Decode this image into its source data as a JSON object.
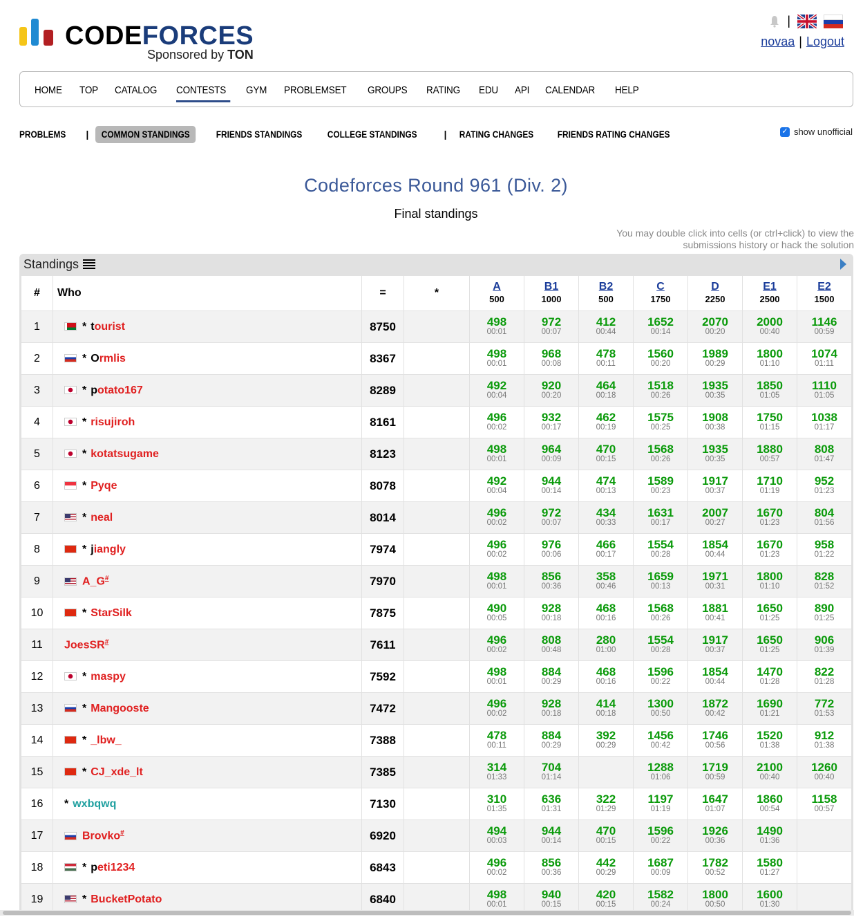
{
  "brand": {
    "word_black": "CODE",
    "word_blue": "FORCES",
    "sponsor_prefix": "Sponsored by",
    "sponsor_name": "TON"
  },
  "header": {
    "separator": "|",
    "user": "novaa",
    "logout": "Logout"
  },
  "menu": [
    "HOME",
    "TOP",
    "CATALOG",
    "CONTESTS",
    "GYM",
    "PROBLEMSET",
    "GROUPS",
    "RATING",
    "EDU",
    "API",
    "CALENDAR",
    "HELP"
  ],
  "menu_active": "CONTESTS",
  "subnav": {
    "problems": "PROBLEMS",
    "common": "COMMON STANDINGS",
    "friends": "FRIENDS STANDINGS",
    "college": "COLLEGE STANDINGS",
    "rating": "RATING CHANGES",
    "friends_rating": "FRIENDS RATING CHANGES",
    "sep": "|"
  },
  "unofficial_label": "show unofficial",
  "contest_title": "Codeforces Round 961 (Div. 2)",
  "standings_status": "Final standings",
  "hint": "You may double click into cells (or ctrl+click) to view the submissions history or hack the solution",
  "panel_title": "Standings",
  "columns": {
    "rank": "#",
    "who": "Who",
    "points": "=",
    "penalty": "*"
  },
  "problems": [
    {
      "label": "A",
      "points": "500"
    },
    {
      "label": "B1",
      "points": "1000"
    },
    {
      "label": "B2",
      "points": "500"
    },
    {
      "label": "C",
      "points": "1750"
    },
    {
      "label": "D",
      "points": "2250"
    },
    {
      "label": "E1",
      "points": "2500"
    },
    {
      "label": "E2",
      "points": "1500"
    }
  ],
  "rows": [
    {
      "rank": "1",
      "flag": "by",
      "star": true,
      "first": "t",
      "rest": "ourist",
      "color": "red",
      "sup": "",
      "score": "8750",
      "cells": [
        [
          "498",
          "00:01"
        ],
        [
          "972",
          "00:07"
        ],
        [
          "412",
          "00:44"
        ],
        [
          "1652",
          "00:14"
        ],
        [
          "2070",
          "00:20"
        ],
        [
          "2000",
          "00:40"
        ],
        [
          "1146",
          "00:59"
        ]
      ]
    },
    {
      "rank": "2",
      "flag": "ru",
      "star": true,
      "first": "O",
      "rest": "rmlis",
      "color": "red",
      "sup": "",
      "score": "8367",
      "cells": [
        [
          "498",
          "00:01"
        ],
        [
          "968",
          "00:08"
        ],
        [
          "478",
          "00:11"
        ],
        [
          "1560",
          "00:20"
        ],
        [
          "1989",
          "00:29"
        ],
        [
          "1800",
          "01:10"
        ],
        [
          "1074",
          "01:11"
        ]
      ]
    },
    {
      "rank": "3",
      "flag": "jp",
      "star": true,
      "first": "p",
      "rest": "otato167",
      "color": "red",
      "sup": "",
      "score": "8289",
      "cells": [
        [
          "492",
          "00:04"
        ],
        [
          "920",
          "00:20"
        ],
        [
          "464",
          "00:18"
        ],
        [
          "1518",
          "00:26"
        ],
        [
          "1935",
          "00:35"
        ],
        [
          "1850",
          "01:05"
        ],
        [
          "1110",
          "01:05"
        ]
      ]
    },
    {
      "rank": "4",
      "flag": "jp",
      "star": true,
      "first": "",
      "rest": "risujiroh",
      "color": "red",
      "sup": "",
      "score": "8161",
      "cells": [
        [
          "496",
          "00:02"
        ],
        [
          "932",
          "00:17"
        ],
        [
          "462",
          "00:19"
        ],
        [
          "1575",
          "00:25"
        ],
        [
          "1908",
          "00:38"
        ],
        [
          "1750",
          "01:15"
        ],
        [
          "1038",
          "01:17"
        ]
      ]
    },
    {
      "rank": "5",
      "flag": "jp",
      "star": true,
      "first": "",
      "rest": "kotatsugame",
      "color": "red",
      "sup": "",
      "score": "8123",
      "cells": [
        [
          "498",
          "00:01"
        ],
        [
          "964",
          "00:09"
        ],
        [
          "470",
          "00:15"
        ],
        [
          "1568",
          "00:26"
        ],
        [
          "1935",
          "00:35"
        ],
        [
          "1880",
          "00:57"
        ],
        [
          "808",
          "01:47"
        ]
      ]
    },
    {
      "rank": "6",
      "flag": "sg",
      "star": true,
      "first": "",
      "rest": "Pyqe",
      "color": "red",
      "sup": "",
      "score": "8078",
      "cells": [
        [
          "492",
          "00:04"
        ],
        [
          "944",
          "00:14"
        ],
        [
          "474",
          "00:13"
        ],
        [
          "1589",
          "00:23"
        ],
        [
          "1917",
          "00:37"
        ],
        [
          "1710",
          "01:19"
        ],
        [
          "952",
          "01:23"
        ]
      ]
    },
    {
      "rank": "7",
      "flag": "us",
      "star": true,
      "first": "",
      "rest": "neal",
      "color": "red",
      "sup": "",
      "score": "8014",
      "cells": [
        [
          "496",
          "00:02"
        ],
        [
          "972",
          "00:07"
        ],
        [
          "434",
          "00:33"
        ],
        [
          "1631",
          "00:17"
        ],
        [
          "2007",
          "00:27"
        ],
        [
          "1670",
          "01:23"
        ],
        [
          "804",
          "01:56"
        ]
      ]
    },
    {
      "rank": "8",
      "flag": "cn",
      "star": true,
      "first": "j",
      "rest": "iangly",
      "color": "red",
      "sup": "",
      "score": "7974",
      "cells": [
        [
          "496",
          "00:02"
        ],
        [
          "976",
          "00:06"
        ],
        [
          "466",
          "00:17"
        ],
        [
          "1554",
          "00:28"
        ],
        [
          "1854",
          "00:44"
        ],
        [
          "1670",
          "01:23"
        ],
        [
          "958",
          "01:22"
        ]
      ]
    },
    {
      "rank": "9",
      "flag": "us",
      "star": false,
      "first": "",
      "rest": "A_G",
      "color": "red",
      "sup": "#",
      "score": "7970",
      "cells": [
        [
          "498",
          "00:01"
        ],
        [
          "856",
          "00:36"
        ],
        [
          "358",
          "00:46"
        ],
        [
          "1659",
          "00:13"
        ],
        [
          "1971",
          "00:31"
        ],
        [
          "1800",
          "01:10"
        ],
        [
          "828",
          "01:52"
        ]
      ]
    },
    {
      "rank": "10",
      "flag": "cn",
      "star": true,
      "first": "",
      "rest": "StarSilk",
      "color": "red",
      "sup": "",
      "score": "7875",
      "cells": [
        [
          "490",
          "00:05"
        ],
        [
          "928",
          "00:18"
        ],
        [
          "468",
          "00:16"
        ],
        [
          "1568",
          "00:26"
        ],
        [
          "1881",
          "00:41"
        ],
        [
          "1650",
          "01:25"
        ],
        [
          "890",
          "01:25"
        ]
      ]
    },
    {
      "rank": "11",
      "flag": "",
      "star": false,
      "first": "",
      "rest": "JoesSR",
      "color": "red",
      "sup": "#",
      "score": "7611",
      "cells": [
        [
          "496",
          "00:02"
        ],
        [
          "808",
          "00:48"
        ],
        [
          "280",
          "01:00"
        ],
        [
          "1554",
          "00:28"
        ],
        [
          "1917",
          "00:37"
        ],
        [
          "1650",
          "01:25"
        ],
        [
          "906",
          "01:39"
        ]
      ]
    },
    {
      "rank": "12",
      "flag": "jp",
      "star": true,
      "first": "",
      "rest": "maspy",
      "color": "red",
      "sup": "",
      "score": "7592",
      "cells": [
        [
          "498",
          "00:01"
        ],
        [
          "884",
          "00:29"
        ],
        [
          "468",
          "00:16"
        ],
        [
          "1596",
          "00:22"
        ],
        [
          "1854",
          "00:44"
        ],
        [
          "1470",
          "01:28"
        ],
        [
          "822",
          "01:28"
        ]
      ]
    },
    {
      "rank": "13",
      "flag": "ru",
      "star": true,
      "first": "",
      "rest": "Mangooste",
      "color": "red",
      "sup": "",
      "score": "7472",
      "cells": [
        [
          "496",
          "00:02"
        ],
        [
          "928",
          "00:18"
        ],
        [
          "414",
          "00:18"
        ],
        [
          "1300",
          "00:50"
        ],
        [
          "1872",
          "00:42"
        ],
        [
          "1690",
          "01:21"
        ],
        [
          "772",
          "01:53"
        ]
      ]
    },
    {
      "rank": "14",
      "flag": "cn",
      "star": true,
      "first": "",
      "rest": "_lbw_",
      "color": "red",
      "sup": "",
      "score": "7388",
      "cells": [
        [
          "478",
          "00:11"
        ],
        [
          "884",
          "00:29"
        ],
        [
          "392",
          "00:29"
        ],
        [
          "1456",
          "00:42"
        ],
        [
          "1746",
          "00:56"
        ],
        [
          "1520",
          "01:38"
        ],
        [
          "912",
          "01:38"
        ]
      ]
    },
    {
      "rank": "15",
      "flag": "cn",
      "star": true,
      "first": "",
      "rest": "CJ_xde_lt",
      "color": "red",
      "sup": "",
      "score": "7385",
      "cells": [
        [
          "314",
          "01:33"
        ],
        [
          "704",
          "01:14"
        ],
        [
          "",
          ""
        ],
        [
          "1288",
          "01:06"
        ],
        [
          "1719",
          "00:59"
        ],
        [
          "2100",
          "00:40"
        ],
        [
          "1260",
          "00:40"
        ]
      ]
    },
    {
      "rank": "16",
      "flag": "",
      "star": true,
      "first": "",
      "rest": "wxbqwq",
      "color": "teal",
      "sup": "",
      "score": "7130",
      "cells": [
        [
          "310",
          "01:35"
        ],
        [
          "636",
          "01:31"
        ],
        [
          "322",
          "01:29"
        ],
        [
          "1197",
          "01:19"
        ],
        [
          "1647",
          "01:07"
        ],
        [
          "1860",
          "00:54"
        ],
        [
          "1158",
          "00:57"
        ]
      ]
    },
    {
      "rank": "17",
      "flag": "ru",
      "star": false,
      "first": "",
      "rest": "Brovko",
      "color": "red",
      "sup": "#",
      "score": "6920",
      "cells": [
        [
          "494",
          "00:03"
        ],
        [
          "944",
          "00:14"
        ],
        [
          "470",
          "00:15"
        ],
        [
          "1596",
          "00:22"
        ],
        [
          "1926",
          "00:36"
        ],
        [
          "1490",
          "01:36"
        ],
        [
          "",
          ""
        ]
      ]
    },
    {
      "rank": "18",
      "flag": "hu",
      "star": true,
      "first": "p",
      "rest": "eti1234",
      "color": "red",
      "sup": "",
      "score": "6843",
      "cells": [
        [
          "496",
          "00:02"
        ],
        [
          "856",
          "00:36"
        ],
        [
          "442",
          "00:29"
        ],
        [
          "1687",
          "00:09"
        ],
        [
          "1782",
          "00:52"
        ],
        [
          "1580",
          "01:27"
        ],
        [
          "",
          ""
        ]
      ]
    },
    {
      "rank": "19",
      "flag": "us",
      "star": true,
      "first": "",
      "rest": "BucketPotato",
      "color": "red",
      "sup": "",
      "score": "6840",
      "cells": [
        [
          "498",
          "00:01"
        ],
        [
          "940",
          "00:15"
        ],
        [
          "420",
          "00:15"
        ],
        [
          "1582",
          "00:24"
        ],
        [
          "1800",
          "00:50"
        ],
        [
          "1600",
          "01:30"
        ],
        [
          "",
          ""
        ]
      ]
    }
  ],
  "colors": {
    "accepted": "#0a9a0a",
    "legendary": "#e02020",
    "master": "#20a0a0",
    "link": "#1a3c9a",
    "title": "#3b5998"
  }
}
